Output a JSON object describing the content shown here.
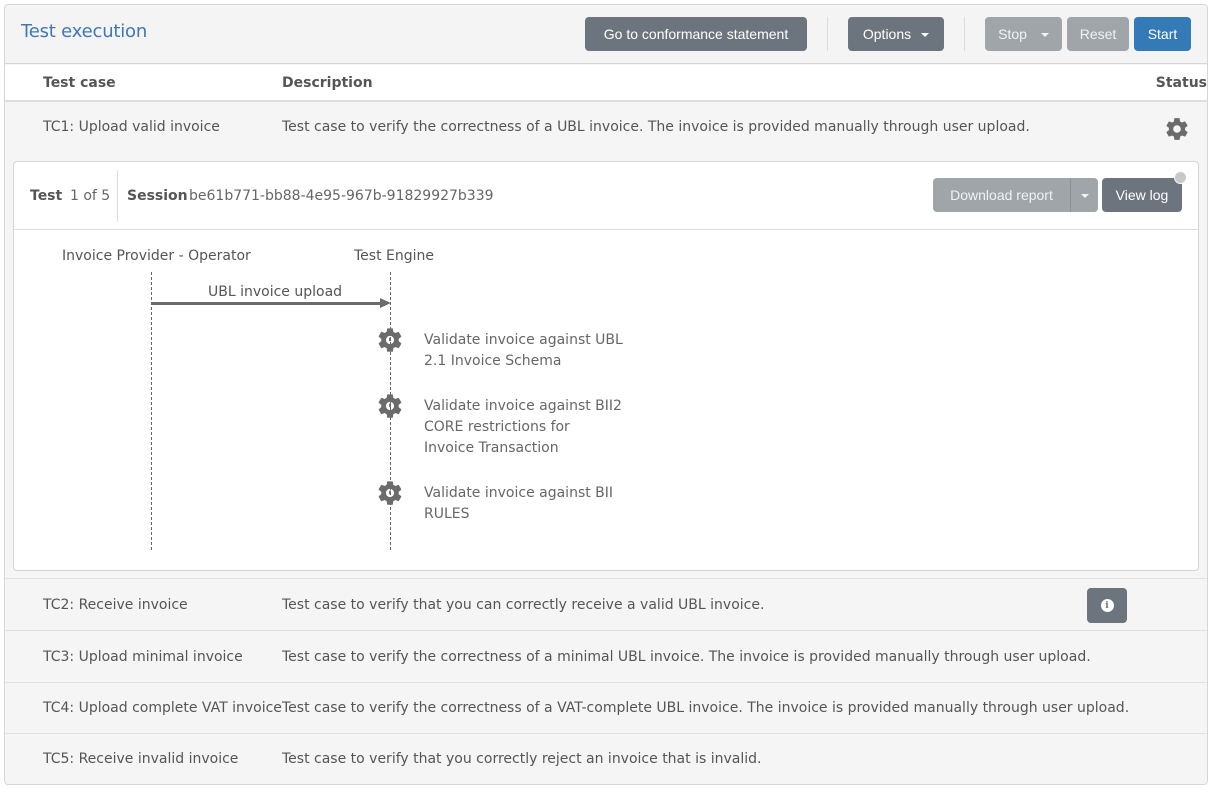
{
  "header": {
    "title": "Test execution",
    "buttons": {
      "conformance": "Go to conformance statement",
      "options": "Options",
      "stop": "Stop",
      "reset": "Reset",
      "start": "Start"
    }
  },
  "table": {
    "columns": [
      "Test case",
      "Description",
      "Status"
    ],
    "rows": [
      {
        "name": "TC1: Upload valid invoice",
        "description": "Test case to verify the correctness of a UBL invoice. The invoice is provided manually through user upload.",
        "status_icon": "gear-icon"
      },
      {
        "name": "TC2: Receive invoice",
        "description": "Test case to verify that you can correctly receive a valid UBL invoice.",
        "status_icon": "info-icon"
      },
      {
        "name": "TC3: Upload minimal invoice",
        "description": "Test case to verify the correctness of a minimal UBL invoice. The invoice is provided manually through user upload."
      },
      {
        "name": "TC4: Upload complete VAT invoice",
        "description": "Test case to verify the correctness of a VAT-complete UBL invoice. The invoice is provided manually through user upload."
      },
      {
        "name": "TC5: Receive invalid invoice",
        "description": "Test case to verify that you correctly reject an invoice that is invalid."
      }
    ]
  },
  "session": {
    "test_label": "Test",
    "test_value": "1 of 5",
    "session_label": "Session",
    "session_id": "be61b771-bb88-4e95-967b-91829927b339",
    "download_report": "Download report",
    "view_log": "View log"
  },
  "diagram": {
    "actors": [
      "Invoice Provider - Operator",
      "Test Engine"
    ],
    "message": "UBL invoice upload",
    "steps": [
      {
        "text": "Validate invoice against UBL 2.1 Invoice Schema",
        "icon": "gear-icon"
      },
      {
        "text": "Validate invoice against BII2 CORE restrictions for Invoice Transaction",
        "icon": "gear-icon"
      },
      {
        "text": "Validate invoice against BII RULES",
        "icon": "gear-icon"
      }
    ]
  },
  "colors": {
    "accent": "#3e78b5",
    "primary_button": "#337ab7",
    "dark_button": "#6c757d",
    "disabled_button": "#a0a5aa"
  }
}
